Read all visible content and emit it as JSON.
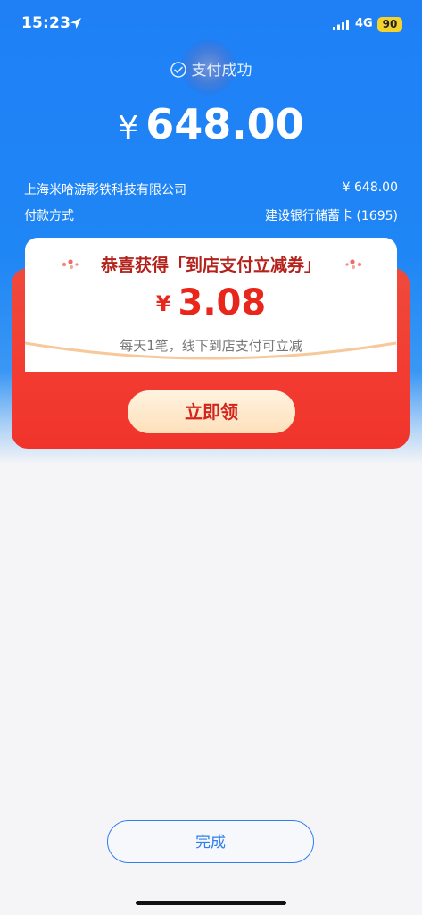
{
  "status_bar": {
    "time": "15:23",
    "network": "4G",
    "battery": "90",
    "icons": [
      "location-arrow-icon",
      "signal-bars-icon"
    ]
  },
  "payment": {
    "status_text": "支付成功",
    "currency": "¥",
    "amount": "648.00"
  },
  "details": {
    "merchant": "上海米哈游影铁科技有限公司",
    "merchant_amount": "¥ 648.00",
    "method_label": "付款方式",
    "method_value": "建设银行储蓄卡 (1695)"
  },
  "coupon": {
    "title": "恭喜获得「到店支付立减券」",
    "currency": "¥",
    "value": "3.08",
    "description": "每天1笔，线下到店支付可立减",
    "claim_label": "立即领"
  },
  "footer": {
    "done_label": "完成"
  },
  "colors": {
    "brand_blue": "#1f80f6",
    "coupon_red": "#f23b31",
    "coupon_title": "#b3221b",
    "coupon_value": "#e8261c",
    "battery": "#f4d22e"
  }
}
